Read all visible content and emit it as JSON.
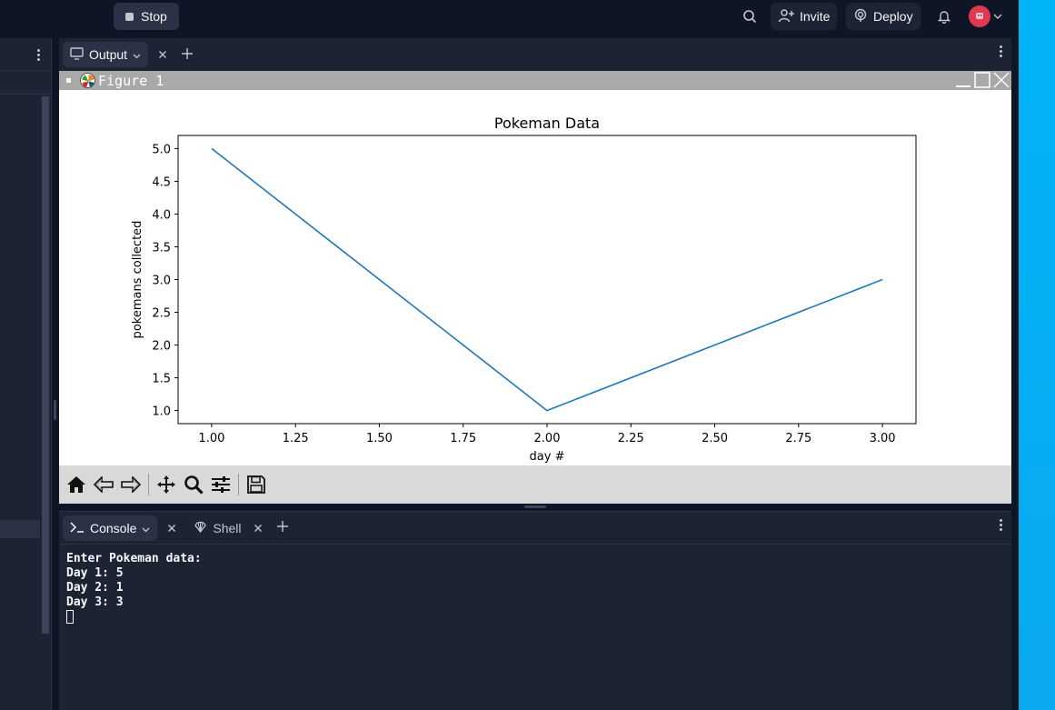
{
  "topbar": {
    "stop_label": "Stop",
    "invite_label": "Invite",
    "deploy_label": "Deploy"
  },
  "output_pane": {
    "tab_label": "Output"
  },
  "figure": {
    "title": "Figure 1"
  },
  "console_pane": {
    "tabs": [
      {
        "label": "Console",
        "icon": "terminal-icon"
      },
      {
        "label": "Shell",
        "icon": "shell-icon"
      }
    ],
    "lines": [
      "Enter Pokeman data:",
      "Day 1: 5",
      "Day 2: 1",
      "Day 3: 3"
    ]
  },
  "colors": {
    "background": "#0e1525",
    "panel": "#1c2333",
    "accent_blue": "#00b4f5",
    "line_series": "#1f77b4"
  },
  "chart_data": {
    "type": "line",
    "title": "Pokeman Data",
    "xlabel": "day #",
    "ylabel": "pokemans collected",
    "x": [
      1,
      2,
      3
    ],
    "series": [
      {
        "values": [
          5,
          1,
          3
        ]
      }
    ],
    "xlim": [
      0.9,
      3.1
    ],
    "ylim": [
      0.8,
      5.2
    ],
    "xticks": [
      "1.00",
      "1.25",
      "1.50",
      "1.75",
      "2.00",
      "2.25",
      "2.50",
      "2.75",
      "3.00"
    ],
    "yticks": [
      "1.0",
      "1.5",
      "2.0",
      "2.5",
      "3.0",
      "3.5",
      "4.0",
      "4.5",
      "5.0"
    ],
    "grid": false
  }
}
